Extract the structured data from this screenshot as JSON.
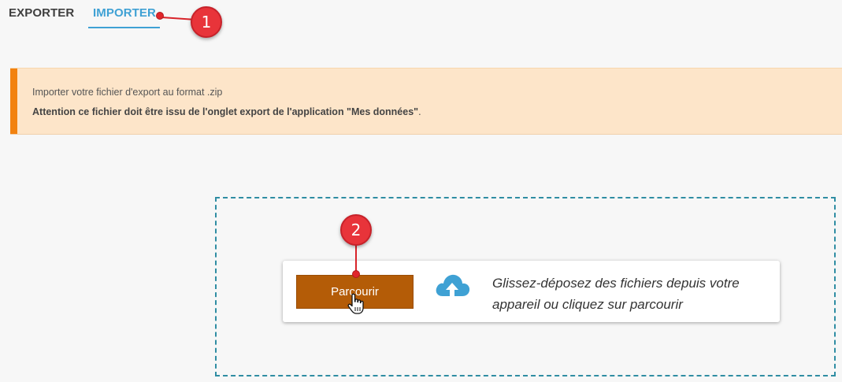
{
  "tabs": [
    {
      "label": "EXPORTER",
      "active": false
    },
    {
      "label": "IMPORTER",
      "active": true
    }
  ],
  "banner": {
    "line1": "Importer votre fichier d'export au format .zip",
    "line2_bold": "Attention ce fichier doit être issu de l'onglet export de l'application \"Mes données\"",
    "line2_tail": "."
  },
  "upload": {
    "browse_label": "Parcourir",
    "drop_text": "Glissez-déposez des fichiers depuis votre appareil ou cliquez sur parcourir"
  },
  "callouts": [
    {
      "number": "1"
    },
    {
      "number": "2"
    }
  ],
  "colors": {
    "tab_active": "#3fa1d4",
    "banner_bg": "#fde5c9",
    "banner_accent": "#f2820f",
    "dropzone_border": "#2f8da3",
    "browse_button": "#b45c07",
    "cloud_icon": "#3fa1d4",
    "callout": "#e8343a"
  }
}
